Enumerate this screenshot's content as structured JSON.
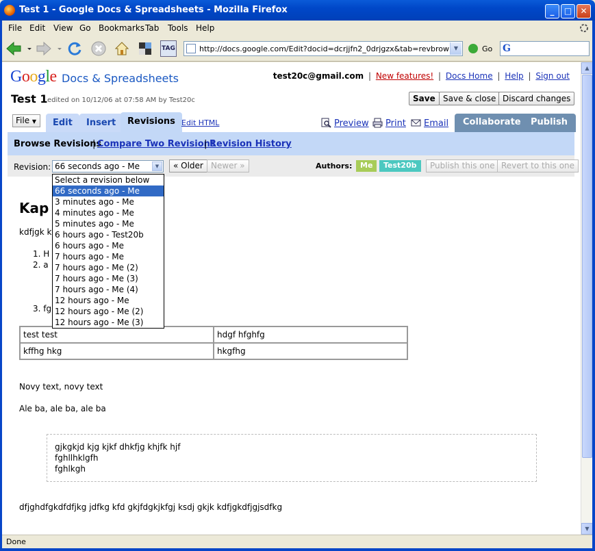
{
  "window": {
    "title": "Test 1 - Google Docs & Spreadsheets - Mozilla Firefox"
  },
  "menu": [
    "File",
    "Edit",
    "View",
    "Go",
    "Bookmarks",
    "Tab",
    "Tools",
    "Help"
  ],
  "toolbar": {
    "url": "http://docs.google.com/Edit?docid=dcrjjfn2_0drjgzx&tab=revbrowse&canc",
    "go_label": "Go",
    "tag_label": "TAG"
  },
  "status": {
    "text": "Done"
  },
  "header": {
    "logo": {
      "g1": "G",
      "o1": "o",
      "o2": "o",
      "g2": "g",
      "l": "l",
      "e": "e"
    },
    "product": "Docs & Spreadsheets",
    "email": "test20c@gmail.com",
    "links": {
      "new_features": "New features!",
      "docs_home": "Docs Home",
      "help": "Help",
      "sign_out": "Sign out"
    },
    "sep": "|"
  },
  "doc": {
    "title": "Test 1",
    "edit_info": "edited on 10/12/06 at 07:58 AM by Test20c",
    "buttons": {
      "save": "Save",
      "save_close": "Save & close",
      "discard": "Discard changes"
    }
  },
  "tabs": {
    "file": "File",
    "edit": "Edit",
    "insert": "Insert",
    "revisions": "Revisions",
    "edit_html": "Edit HTML",
    "preview": "Preview",
    "print": "Print",
    "email": "Email",
    "collaborate": "Collaborate",
    "publish": "Publish"
  },
  "browse": {
    "current": "Browse Revisions",
    "compare": "Compare Two Revisions",
    "history": "Revision History",
    "sep": "|"
  },
  "revision": {
    "label": "Revision:",
    "selected": "66 seconds ago - Me",
    "older": "« Older",
    "newer": "Newer »",
    "authors_label": "Authors:",
    "authors": [
      {
        "name": "Me",
        "color": "#a8cc58"
      },
      {
        "name": "Test20b",
        "color": "#4cc8c0"
      }
    ],
    "publish_btn": "Publish this one",
    "revert_btn": "Revert to this one",
    "options": [
      "Select a revision below",
      "66 seconds ago - Me",
      "3 minutes ago - Me",
      "4 minutes ago - Me",
      "5 minutes ago - Me",
      "6 hours ago - Test20b",
      "6 hours ago - Me",
      "7 hours ago - Me",
      "7 hours ago - Me (2)",
      "7 hours ago - Me (3)",
      "7 hours ago - Me (4)",
      "12 hours ago - Me",
      "12 hours ago - Me (2)",
      "12 hours ago - Me (3)"
    ],
    "selected_index": 1
  },
  "content": {
    "heading": "Kap",
    "para1": "kdfjgk k",
    "list": [
      "1.  H",
      "2.  a",
      "3.  fg"
    ],
    "table": [
      [
        "test test",
        "hdgf hfghfg"
      ],
      [
        "kffhg hkg",
        "hkgfhg"
      ]
    ],
    "novy": "Novy text, novy text",
    "ale": "Ale ba, ale ba, ale ba",
    "code": [
      "gjkgkjd kjg kjkf dhkfjg khjfk hjf",
      "fghllhklgfh",
      "fghlkgh"
    ],
    "last": "dfjghdfgkdfdfjkg jdfkg kfd gkjfdgkjkfgj ksdj gkjk kdfjgkdfjgjsdfkg"
  }
}
